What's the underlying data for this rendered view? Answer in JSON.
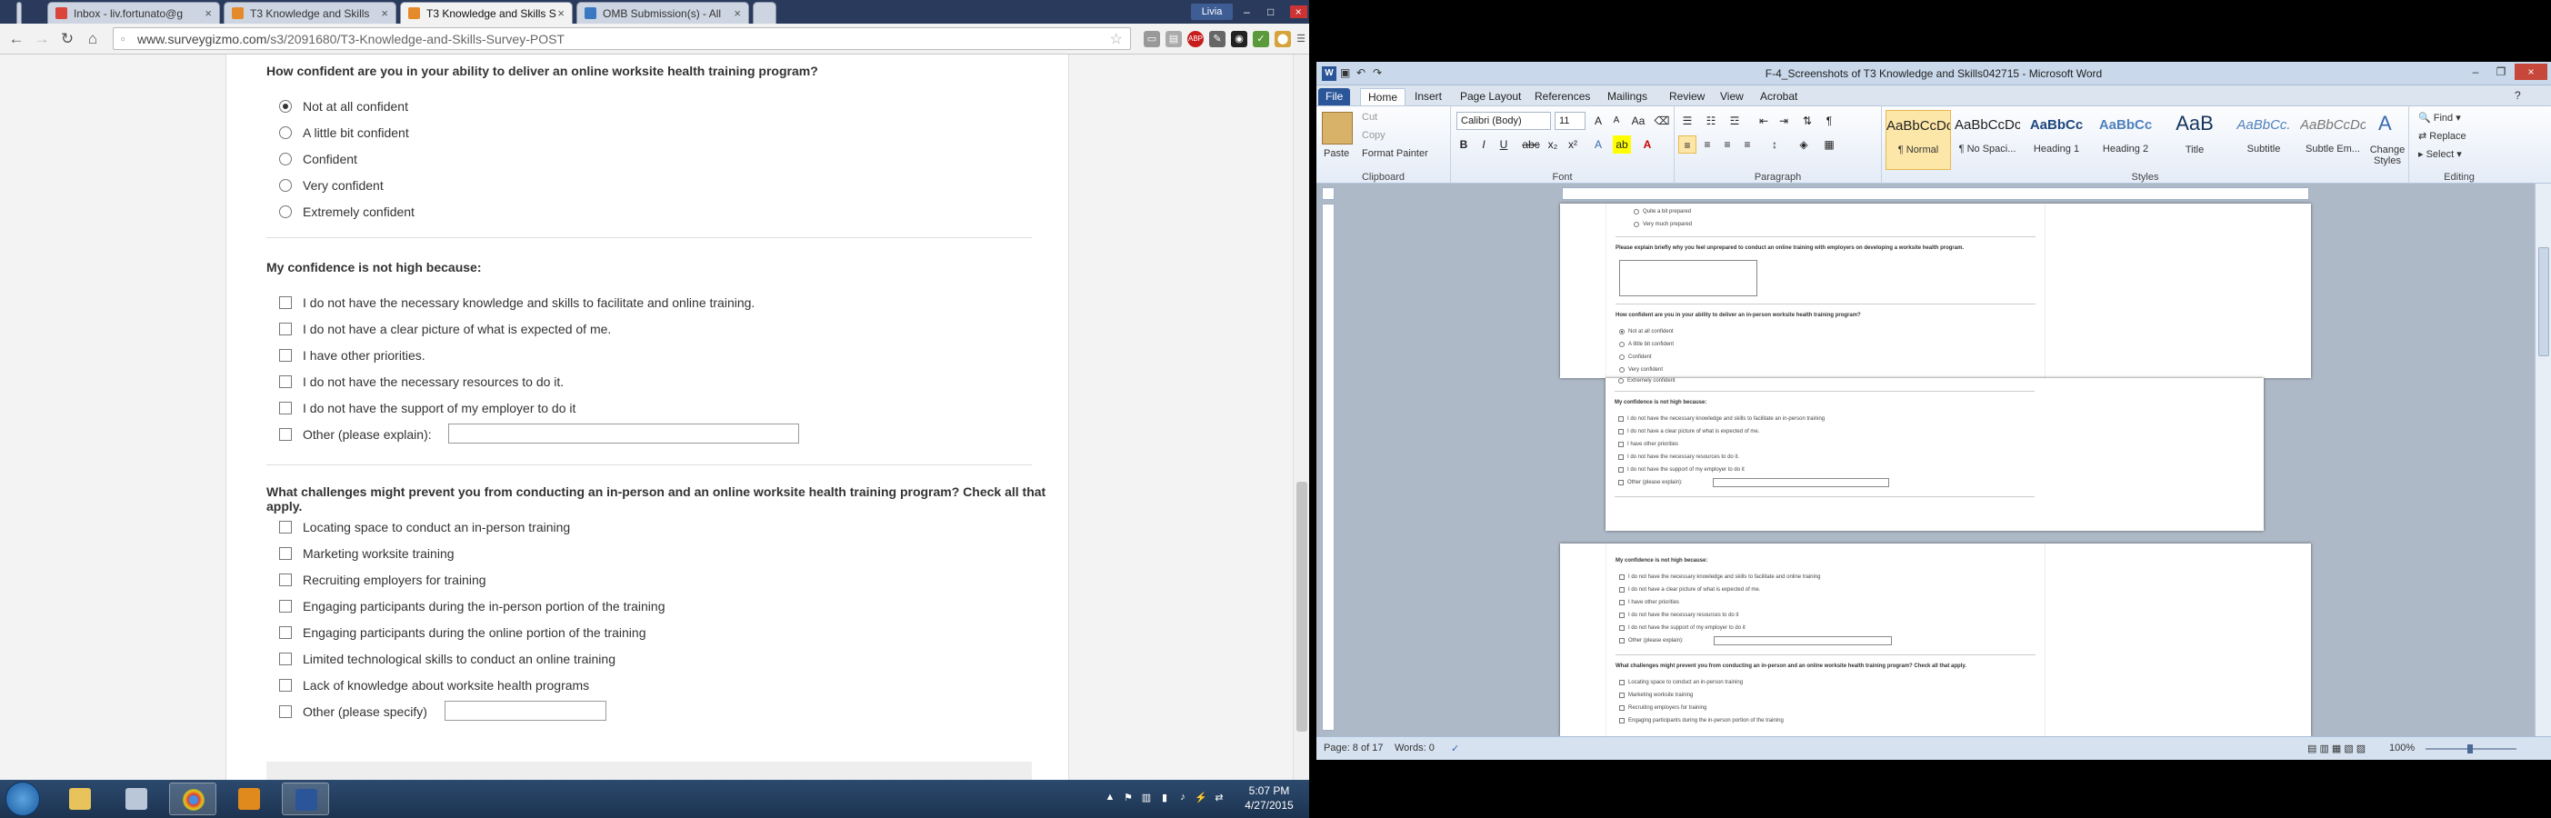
{
  "chrome": {
    "tabs": [
      {
        "title": "Inbox - liv.fortunato@g",
        "active": false
      },
      {
        "title": "T3 Knowledge and Skills",
        "active": false
      },
      {
        "title": "T3 Knowledge and Skills S",
        "active": true
      },
      {
        "title": "OMB Submission(s) - All",
        "active": false
      }
    ],
    "url_host": "www.surveygizmo.com",
    "url_path": "/s3/2091680/T3-Knowledge-and-Skills-Survey-POST",
    "profile": "Livia",
    "ext_abp": "ABP"
  },
  "survey": {
    "q1": {
      "text": "How confident are you in your ability to deliver an online worksite health training program?",
      "options": [
        "Not at all confident",
        "A little bit confident",
        "Confident",
        "Very confident",
        "Extremely confident"
      ],
      "selected_index": 0
    },
    "q2": {
      "text": "My confidence is not high because:",
      "options": [
        "I do not have the necessary knowledge and skills to facilitate and online training.",
        "I do not have a clear picture of what is expected of me.",
        "I have other priorities.",
        "I do not have the necessary resources to do it.",
        "I do not have the support of my employer to do it",
        "Other (please explain):"
      ]
    },
    "q3": {
      "text": "What challenges might prevent you from conducting an in-person and an online worksite health training program? Check all that apply.",
      "options": [
        "Locating space to conduct an in-person training",
        "Marketing worksite training",
        "Recruiting employers for training",
        "Engaging participants during the in-person portion of the training",
        "Engaging participants during the online portion of the training",
        "Limited technological skills to conduct an online training",
        "Lack of knowledge about worksite health programs",
        "Other (please specify)"
      ]
    }
  },
  "word": {
    "title": "F-4_Screenshots of T3 Knowledge and Skills042715 - Microsoft Word",
    "tabs": [
      "File",
      "Home",
      "Insert",
      "Page Layout",
      "References",
      "Mailings",
      "Review",
      "View",
      "Acrobat"
    ],
    "clipboard": {
      "paste": "Paste",
      "cut": "Cut",
      "copy": "Copy",
      "painter": "Format Painter",
      "label": "Clipboard"
    },
    "font": {
      "name": "Calibri (Body)",
      "size": "11",
      "label": "Font"
    },
    "paragraph_label": "Paragraph",
    "styles": [
      {
        "preview": "AaBbCcDc",
        "name": "¶ Normal"
      },
      {
        "preview": "AaBbCcDc",
        "name": "¶ No Spaci..."
      },
      {
        "preview": "AaBbCc",
        "name": "Heading 1"
      },
      {
        "preview": "AaBbCc",
        "name": "Heading 2"
      },
      {
        "preview": "AaB",
        "name": "Title"
      },
      {
        "preview": "AaBbCc.",
        "name": "Subtitle"
      },
      {
        "preview": "AaBbCcDc",
        "name": "Subtle Em..."
      }
    ],
    "styles_label": "Styles",
    "change_styles": "Change Styles",
    "editing": {
      "find": "Find",
      "replace": "Replace",
      "select": "Select",
      "label": "Editing"
    },
    "doc": {
      "prev_opts": [
        "Quite a bit prepared",
        "Very much prepared"
      ],
      "explain_q": "Please explain briefly why you feel unprepared to conduct an online training with employers on developing a worksite health program.",
      "conf_q": "How confident are you in your ability to deliver an in-person worksite health training program?",
      "conf_opts": [
        "Not at all confident",
        "A little bit confident",
        "Confident",
        "Very confident",
        "Extremely confident"
      ],
      "why_q": "My confidence is not high because:",
      "why_opts_a": [
        "I do not have the necessary knowledge and skills to facilitate an in-person training",
        "I do not have a clear picture of what is expected of me.",
        "I have other priorities",
        "I do not have the necessary resources to do it.",
        "I do not have the support of my employer to do it",
        "Other (please explain):"
      ],
      "why_opts_b": [
        "I do not have the necessary knowledge and skills to facilitate and online training",
        "I do not have a clear picture of what is expected of me.",
        "I have other priorities",
        "I do not have the necessary resources to do it",
        "I do not have the support of my employer to do it",
        "Other (please explain):"
      ],
      "chal_q": "What challenges might prevent you from conducting an in-person and an online worksite health training program? Check all that apply.",
      "chal_opts": [
        "Locating space to conduct an in-person training",
        "Marketing worksite training",
        "Recruiting employers for training",
        "Engaging participants during the in-person portion of the training"
      ]
    },
    "status": {
      "page": "Page: 8 of 17",
      "words": "Words: 0",
      "zoom": "100%"
    }
  },
  "taskbar": {
    "time": "5:07 PM",
    "date": "4/27/2015"
  }
}
